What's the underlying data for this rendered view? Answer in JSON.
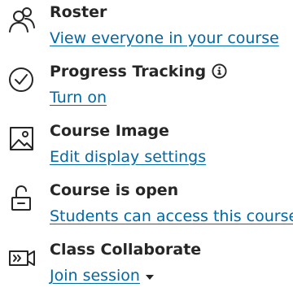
{
  "items": [
    {
      "icon": "roster-icon",
      "title": "Roster",
      "link": "View everyone in your course"
    },
    {
      "icon": "progress-check-icon",
      "title": "Progress Tracking",
      "info_icon": "info-icon",
      "link": "Turn on"
    },
    {
      "icon": "course-image-icon",
      "title": "Course Image",
      "link": "Edit display settings"
    },
    {
      "icon": "unlocked-icon",
      "title": "Course is open",
      "link": "Students can access this course"
    },
    {
      "icon": "video-collaborate-icon",
      "title": "Class Collaborate",
      "link": "Join session",
      "dropdown_icon": "caret-down-icon"
    }
  ],
  "colors": {
    "text": "#262626",
    "link": "#0068a5",
    "background": "#ffffff"
  }
}
